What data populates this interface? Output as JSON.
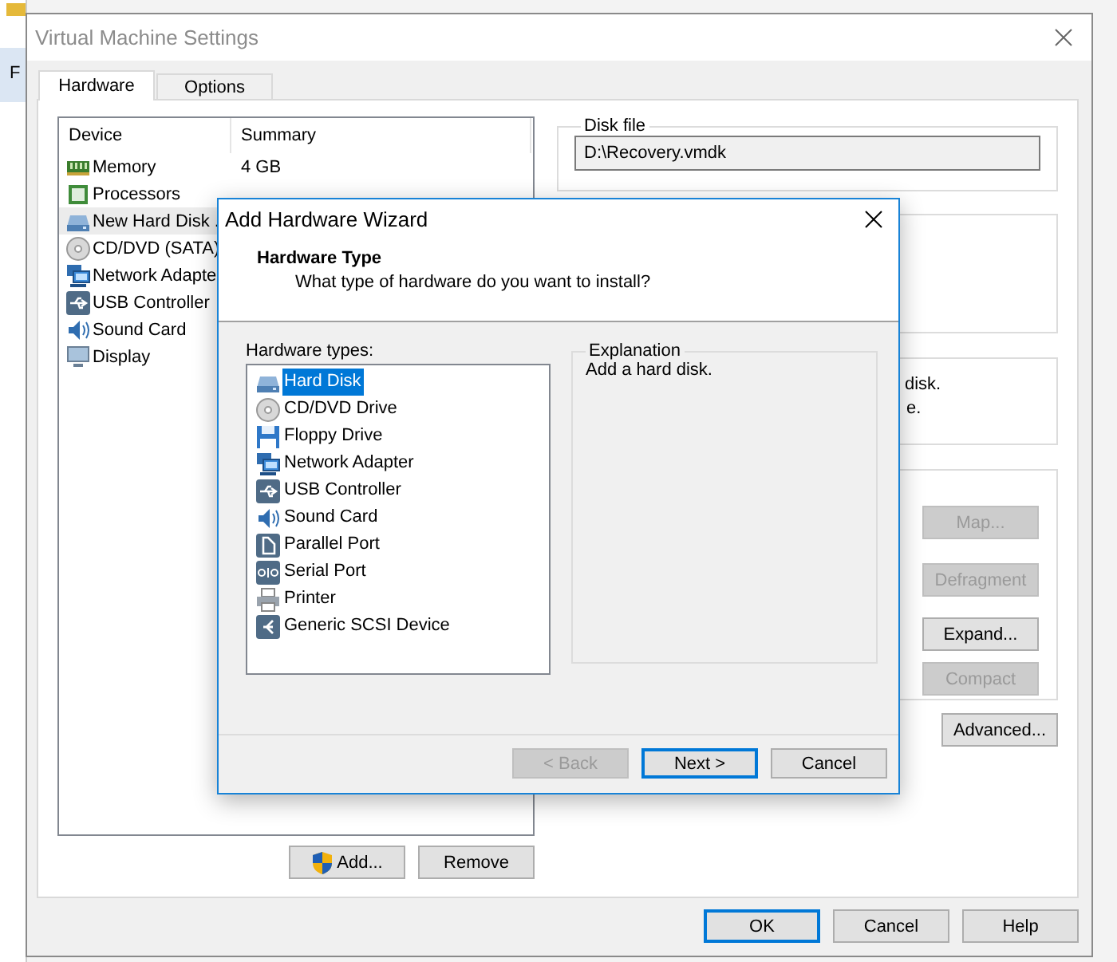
{
  "background_window": {
    "text": "F"
  },
  "window": {
    "title": "Virtual Machine Settings",
    "active": false
  },
  "tabs": [
    {
      "label": "Hardware",
      "selected": true
    },
    {
      "label": "Options",
      "selected": false
    }
  ],
  "device_list": {
    "columns": [
      "Device",
      "Summary"
    ],
    "rows": [
      {
        "device": "Memory",
        "kind": "memory",
        "summary": "4 GB",
        "selected": false
      },
      {
        "device": "Processors",
        "kind": "processor",
        "selected": false
      },
      {
        "device": "New Hard Disk .",
        "kind": "harddisk",
        "selected": true
      },
      {
        "device": "CD/DVD (SATA)",
        "kind": "cdrom",
        "selected": false
      },
      {
        "device": "Network Adapte",
        "kind": "network",
        "selected": false
      },
      {
        "device": "USB Controller",
        "kind": "usb",
        "selected": false
      },
      {
        "device": "Sound Card",
        "kind": "sound",
        "selected": false
      },
      {
        "device": "Display",
        "kind": "display",
        "selected": false
      }
    ]
  },
  "list_buttons": [
    {
      "label": "Add...",
      "shield": true
    },
    {
      "label": "Remove",
      "shield": false
    }
  ],
  "disk_file": {
    "label": "Disk file",
    "value": "D:\\Recovery.vmdk"
  },
  "info_lines": [
    "disk.",
    "e."
  ],
  "utility_buttons": [
    {
      "label": "Map...",
      "disabled": true
    },
    {
      "label": "Defragment",
      "disabled": true
    },
    {
      "label": "Expand...",
      "disabled": false
    },
    {
      "label": "Compact",
      "disabled": true
    }
  ],
  "advanced_button": {
    "label": "Advanced..."
  },
  "dialog_buttons": [
    {
      "label": "OK",
      "default": true
    },
    {
      "label": "Cancel",
      "default": false
    },
    {
      "label": "Help",
      "default": false
    }
  ],
  "wizard": {
    "title": "Add Hardware Wizard",
    "heading": "Hardware Type",
    "subheading": "What type of hardware do you want to install?",
    "list_label": "Hardware types:",
    "items": [
      {
        "label": "Hard Disk",
        "kind": "harddisk",
        "selected": true
      },
      {
        "label": "CD/DVD Drive",
        "kind": "cdrom",
        "selected": false
      },
      {
        "label": "Floppy Drive",
        "kind": "floppy",
        "selected": false
      },
      {
        "label": "Network Adapter",
        "kind": "network",
        "selected": false
      },
      {
        "label": "USB Controller",
        "kind": "usb",
        "selected": false
      },
      {
        "label": "Sound Card",
        "kind": "sound",
        "selected": false
      },
      {
        "label": "Parallel Port",
        "kind": "parallel",
        "selected": false
      },
      {
        "label": "Serial Port",
        "kind": "serial",
        "selected": false
      },
      {
        "label": "Printer",
        "kind": "printer",
        "selected": false
      },
      {
        "label": "Generic SCSI Device",
        "kind": "scsi",
        "selected": false
      }
    ],
    "explanation": {
      "label": "Explanation",
      "text": "Add a hard disk."
    },
    "buttons": [
      {
        "label": "< Back",
        "disabled": true,
        "default": false
      },
      {
        "label": "Next >",
        "disabled": false,
        "default": true
      },
      {
        "label": "Cancel",
        "disabled": false,
        "default": false
      }
    ]
  }
}
